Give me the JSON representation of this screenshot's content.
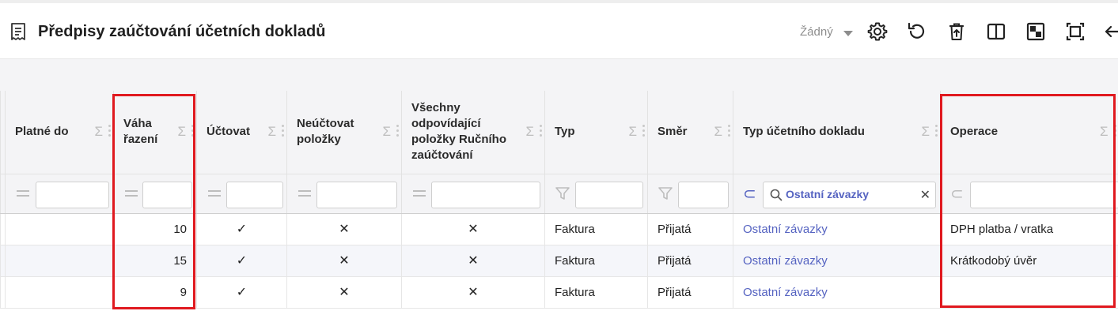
{
  "header": {
    "title": "Předpisy zaúčtování účetních dokladů",
    "view_selector": "Žádný"
  },
  "toolbar": {
    "icons": [
      "settings-icon",
      "undo-icon",
      "delete-icon",
      "split-view-icon",
      "toggle-view-icon",
      "fit-screen-icon",
      "back-arrow-icon"
    ]
  },
  "table": {
    "columns": [
      {
        "label": ""
      },
      {
        "label": "Platné do"
      },
      {
        "label": "Váha řazení"
      },
      {
        "label": "Účtovat"
      },
      {
        "label": "Neúčtovat položky"
      },
      {
        "label": "Všechny odpovídající položky Ručního zaúčtování"
      },
      {
        "label": "Typ"
      },
      {
        "label": "Směr"
      },
      {
        "label": "Typ účetního dokladu"
      },
      {
        "label": "Operace"
      }
    ],
    "filters": {
      "typ_dokladu": "Ostatní závazky"
    },
    "rows": [
      {
        "vaha": "10",
        "uctovat": "✓",
        "neuctovat": "✕",
        "vsechny": "✕",
        "typ": "Faktura",
        "smer": "Přijatá",
        "typ_dokladu": "Ostatní závazky",
        "operace": "DPH platba / vratka"
      },
      {
        "vaha": "15",
        "uctovat": "✓",
        "neuctovat": "✕",
        "vsechny": "✕",
        "typ": "Faktura",
        "smer": "Přijatá",
        "typ_dokladu": "Ostatní závazky",
        "operace": "Krátkodobý úvěr"
      },
      {
        "vaha": "9",
        "uctovat": "✓",
        "neuctovat": "✕",
        "vsechny": "✕",
        "typ": "Faktura",
        "smer": "Přijatá",
        "typ_dokladu": "Ostatní závazky",
        "operace": ""
      }
    ]
  },
  "colors": {
    "accent": "#5563c1",
    "highlight": "#e0191f",
    "header_bg": "#f4f4f6"
  }
}
